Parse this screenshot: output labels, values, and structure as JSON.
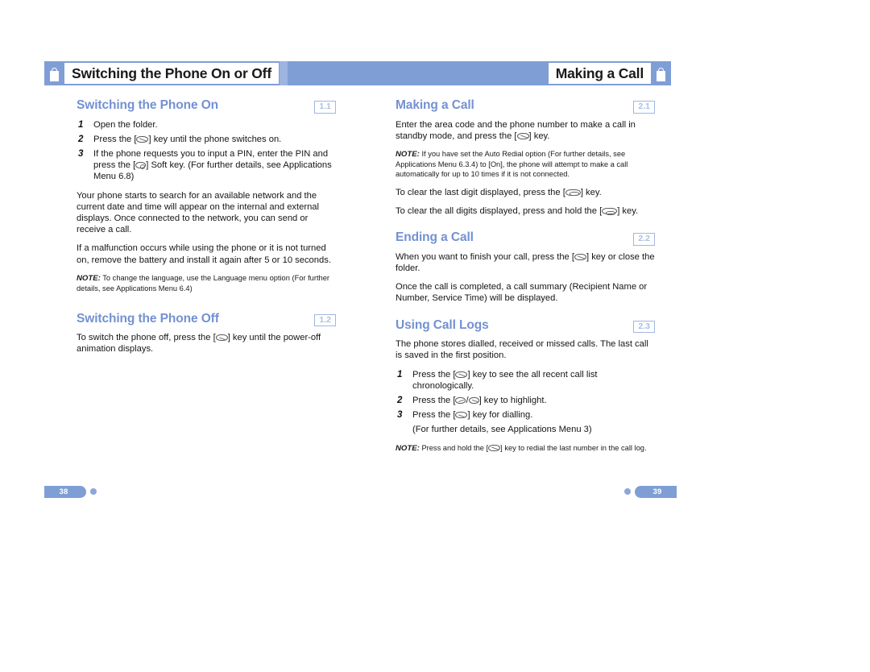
{
  "header": {
    "left_tab_label": "Switching the Phone On or Off",
    "right_tab_label": "Making a Call",
    "icon_left": "mobile-phone-icon",
    "icon_right": "mobile-phone-icon",
    "band_color": "#7f9ed6"
  },
  "theme": {
    "accent_blue": "#7f9ed6",
    "heading_blue": "#7391d2",
    "section_number_blue": "#a9c0e6",
    "body_text": "#161616"
  },
  "left_column": {
    "sections": [
      {
        "title": "Switching the Phone On",
        "number": "1.1",
        "steps": [
          {
            "num": "1",
            "parts": [
              {
                "t": "Open the folder."
              }
            ]
          },
          {
            "num": "2",
            "parts": [
              {
                "t": "Press the ["
              },
              {
                "key": "send"
              },
              {
                "t": "] key until the phone switches on."
              }
            ]
          },
          {
            "num": "3",
            "parts": [
              {
                "t": "If the phone requests you to input a PIN, enter the PIN and press the ["
              },
              {
                "key": "soft"
              },
              {
                "t": "] Soft key. (For further details, see Applications Menu 6.8)"
              }
            ]
          }
        ],
        "paragraphs": [
          "Your phone starts to search for an available network and the current date and time will appear on the internal and external displays. Once connected to the network, you can send or receive a call.",
          "If a malfunction occurs while using the phone or it is not turned on, remove the battery and install it again after 5 or 10 seconds."
        ],
        "note": {
          "label": "NOTE:",
          "text": "To change the language, use the Language menu option (For further details, see Applications Menu 6.4)"
        }
      },
      {
        "title": "Switching the Phone Off",
        "number": "1.2",
        "paragraph_parts": [
          {
            "t": "To switch the phone off, press the ["
          },
          {
            "key": "send"
          },
          {
            "t": "] key until the power-off animation displays."
          }
        ]
      }
    ]
  },
  "right_column": {
    "sections": [
      {
        "title": "Making a Call",
        "number": "2.1",
        "paragraph_parts": [
          {
            "t": "Enter the area code and the phone number to make a call in standby mode, and press the ["
          },
          {
            "key": "call"
          },
          {
            "t": "] key."
          }
        ],
        "note": {
          "label": "NOTE:",
          "text": "If you have set the Auto Redial option (For further details, see Applications Menu 6.3.4) to [On], the phone will attempt to make a call automatically for up to 10 times if it is not connected."
        },
        "after_parts": [
          [
            {
              "t": "To clear the last digit displayed, press the ["
            },
            {
              "key": "clear"
            },
            {
              "t": "] key."
            }
          ],
          [
            {
              "t": "To clear the all digits displayed, press and hold the ["
            },
            {
              "key": "clear"
            },
            {
              "t": "] key."
            }
          ]
        ]
      },
      {
        "title": "Ending a Call",
        "number": "2.2",
        "paragraph_parts": [
          {
            "t": "When you want to finish your call, press the ["
          },
          {
            "key": "send"
          },
          {
            "t": "] key or close the folder."
          }
        ],
        "paragraph2": "Once the call is completed, a call summary (Recipient Name or Number, Service Time) will be displayed."
      },
      {
        "title": "Using Call Logs",
        "number": "2.3",
        "paragraph": "The phone stores dialled, received or missed calls. The last call is saved in the first position.",
        "steps": [
          {
            "num": "1",
            "parts": [
              {
                "t": "Press the ["
              },
              {
                "key": "call"
              },
              {
                "t": "] key to see the all recent call list chronologically."
              }
            ]
          },
          {
            "num": "2",
            "parts": [
              {
                "t": "Press the ["
              },
              {
                "key": "nav"
              },
              {
                "t": "/"
              },
              {
                "key": "navdn"
              },
              {
                "t": "] key to highlight."
              }
            ]
          },
          {
            "num": "3",
            "parts": [
              {
                "t": "Press the ["
              },
              {
                "key": "call"
              },
              {
                "t": "] key for dialling."
              }
            ]
          },
          {
            "num": "",
            "parts": [
              {
                "t": "(For further details, see Applications Menu 3)"
              }
            ]
          }
        ],
        "note": {
          "label": "NOTE:",
          "text_before": "Press and hold the [",
          "key": "call",
          "text_after": "] key to redial the last number in the call log."
        }
      }
    ]
  },
  "footer": {
    "left_page": "38",
    "right_page": "39"
  }
}
